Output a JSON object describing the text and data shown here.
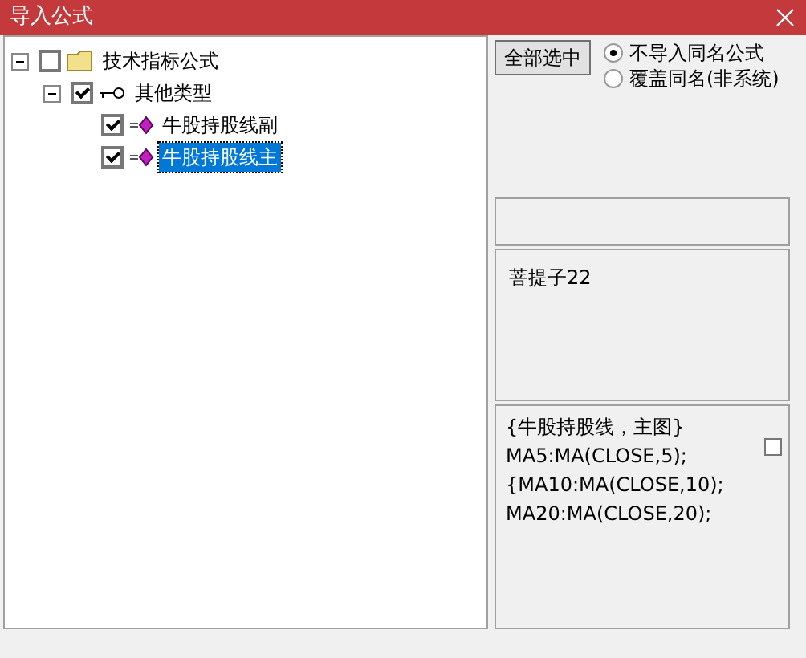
{
  "window": {
    "title": "导入公式"
  },
  "tree": [
    {
      "label": "技术指标公式",
      "kind": "folder",
      "checked": false,
      "expanded": true,
      "selected": false,
      "children": [
        {
          "label": "其他类型",
          "kind": "category",
          "checked": true,
          "expanded": true,
          "selected": false,
          "children": [
            {
              "label": "牛股持股线副",
              "kind": "formula",
              "checked": true,
              "selected": false
            },
            {
              "label": "牛股持股线主",
              "kind": "formula",
              "checked": true,
              "selected": true
            }
          ]
        }
      ]
    }
  ],
  "select_all_button": "全部选中",
  "options": [
    {
      "label": "不导入同名公式",
      "selected": true
    },
    {
      "label": "覆盖同名(非系统)",
      "selected": false
    }
  ],
  "author": "菩提子22",
  "code": {
    "lines": [
      "{牛股持股线，主图}",
      "MA5:MA(CLOSE,5);",
      "{MA10:MA(CLOSE,10);",
      "MA20:MA(CLOSE,20);"
    ],
    "checked": false
  }
}
